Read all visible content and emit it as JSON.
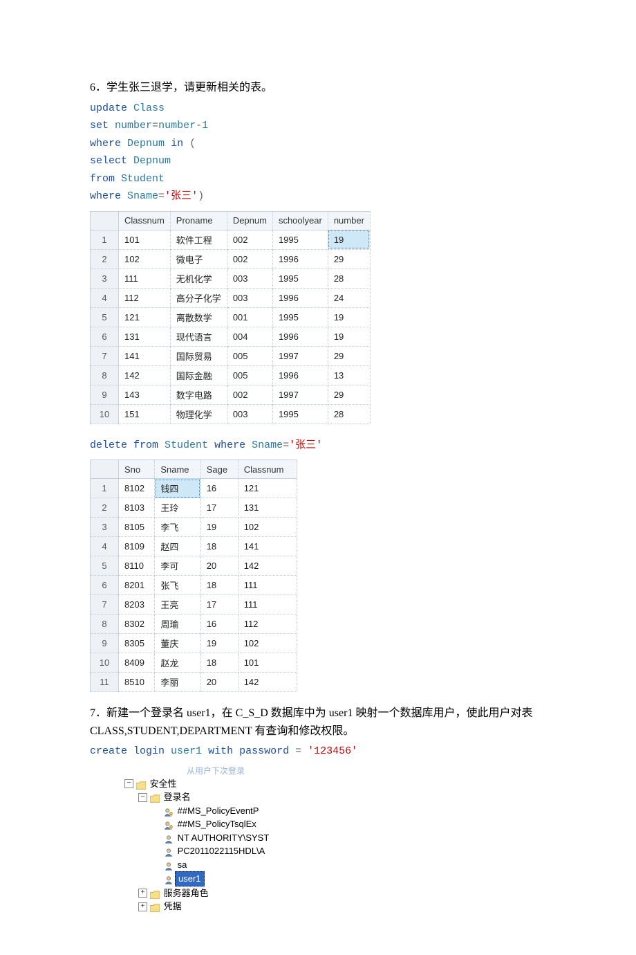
{
  "section6": {
    "title": "6．学生张三退学，请更新相关的表。",
    "sql_lines": [
      [
        {
          "t": "update",
          "c": "kw"
        },
        {
          "t": " ",
          "c": ""
        },
        {
          "t": "Class",
          "c": "id"
        }
      ],
      [
        {
          "t": "set",
          "c": "kw"
        },
        {
          "t": " ",
          "c": ""
        },
        {
          "t": "number",
          "c": "id"
        },
        {
          "t": "=",
          "c": "op"
        },
        {
          "t": "number",
          "c": "id"
        },
        {
          "t": "-",
          "c": "op"
        },
        {
          "t": "1",
          "c": "id"
        }
      ],
      [
        {
          "t": "where",
          "c": "kw"
        },
        {
          "t": " ",
          "c": ""
        },
        {
          "t": "Depnum",
          "c": "id"
        },
        {
          "t": " ",
          "c": ""
        },
        {
          "t": "in",
          "c": "kw"
        },
        {
          "t": " (",
          "c": "op"
        }
      ],
      [
        {
          "t": "select",
          "c": "kw"
        },
        {
          "t": " ",
          "c": ""
        },
        {
          "t": "Depnum",
          "c": "id"
        }
      ],
      [
        {
          "t": "from",
          "c": "kw"
        },
        {
          "t": " ",
          "c": ""
        },
        {
          "t": "Student",
          "c": "id"
        }
      ],
      [
        {
          "t": "where",
          "c": "kw"
        },
        {
          "t": " ",
          "c": ""
        },
        {
          "t": "Sname",
          "c": "id"
        },
        {
          "t": "=",
          "c": "op"
        },
        {
          "t": "'张三'",
          "c": "str"
        },
        {
          "t": ")",
          "c": "op"
        }
      ]
    ],
    "table1": {
      "headers": [
        "",
        "Classnum",
        "Proname",
        "Depnum",
        "schoolyear",
        "number"
      ],
      "rows": [
        [
          "1",
          "101",
          "软件工程",
          "002",
          "1995",
          "19"
        ],
        [
          "2",
          "102",
          "微电子",
          "002",
          "1996",
          "29"
        ],
        [
          "3",
          "111",
          "无机化学",
          "003",
          "1995",
          "28"
        ],
        [
          "4",
          "112",
          "高分子化学",
          "003",
          "1996",
          "24"
        ],
        [
          "5",
          "121",
          "离散数学",
          "001",
          "1995",
          "19"
        ],
        [
          "6",
          "131",
          "现代语言",
          "004",
          "1996",
          "19"
        ],
        [
          "7",
          "141",
          "国际贸易",
          "005",
          "1997",
          "29"
        ],
        [
          "8",
          "142",
          "国际金融",
          "005",
          "1996",
          "13"
        ],
        [
          "9",
          "143",
          "数字电路",
          "002",
          "1997",
          "29"
        ],
        [
          "10",
          "151",
          "物理化学",
          "003",
          "1995",
          "28"
        ]
      ],
      "highlight": {
        "row": 0,
        "col": 5
      }
    },
    "sql_delete": [
      [
        {
          "t": "delete from",
          "c": "kw"
        },
        {
          "t": " ",
          "c": ""
        },
        {
          "t": "Student",
          "c": "id"
        },
        {
          "t": " ",
          "c": ""
        },
        {
          "t": "where",
          "c": "kw"
        },
        {
          "t": " ",
          "c": ""
        },
        {
          "t": "Sname",
          "c": "id"
        },
        {
          "t": "=",
          "c": "op"
        },
        {
          "t": "'张三'",
          "c": "str"
        }
      ]
    ],
    "table2": {
      "headers": [
        "",
        "Sno",
        "Sname",
        "Sage",
        "Classnum"
      ],
      "rows": [
        [
          "1",
          "8102",
          "钱四",
          "16",
          "121"
        ],
        [
          "2",
          "8103",
          "王玲",
          "17",
          "131"
        ],
        [
          "3",
          "8105",
          "李飞",
          "19",
          "102"
        ],
        [
          "4",
          "8109",
          "赵四",
          "18",
          "141"
        ],
        [
          "5",
          "8110",
          "李可",
          "20",
          "142"
        ],
        [
          "6",
          "8201",
          "张飞",
          "18",
          "111"
        ],
        [
          "7",
          "8203",
          "王亮",
          "17",
          "111"
        ],
        [
          "8",
          "8302",
          "周瑜",
          "16",
          "112"
        ],
        [
          "9",
          "8305",
          "董庆",
          "19",
          "102"
        ],
        [
          "10",
          "8409",
          "赵龙",
          "18",
          "101"
        ],
        [
          "11",
          "8510",
          "李丽",
          "20",
          "142"
        ]
      ],
      "highlight": {
        "row": 0,
        "col": 2
      }
    }
  },
  "section7": {
    "title": "7．新建一个登录名 user1，在 C_S_D 数据库中为 user1 映射一个数据库用户，使此用户对表CLASS,STUDENT,DEPARTMENT 有查询和修改权限。",
    "sql_lines": [
      [
        {
          "t": "create login",
          "c": "kw"
        },
        {
          "t": " ",
          "c": ""
        },
        {
          "t": "user1",
          "c": "id"
        },
        {
          "t": " ",
          "c": ""
        },
        {
          "t": "with password",
          "c": "kw"
        },
        {
          "t": " = ",
          "c": "op"
        },
        {
          "t": "'123456'",
          "c": "str"
        }
      ]
    ],
    "tree": {
      "cut_top_text": "从用户下次登录",
      "nodes": [
        {
          "depth": 0,
          "exp": "-",
          "icon": "folder",
          "label": "安全性"
        },
        {
          "depth": 1,
          "exp": "-",
          "icon": "folder",
          "label": "登录名"
        },
        {
          "depth": 2,
          "exp": "",
          "icon": "user-key",
          "label": "##MS_PolicyEventP"
        },
        {
          "depth": 2,
          "exp": "",
          "icon": "user-key",
          "label": "##MS_PolicyTsqlEx"
        },
        {
          "depth": 2,
          "exp": "",
          "icon": "user",
          "label": "NT AUTHORITY\\SYST"
        },
        {
          "depth": 2,
          "exp": "",
          "icon": "user",
          "label": "PC2011022115HDL\\A"
        },
        {
          "depth": 2,
          "exp": "",
          "icon": "user",
          "label": "sa"
        },
        {
          "depth": 2,
          "exp": "",
          "icon": "user",
          "label": "user1",
          "selected": true
        },
        {
          "depth": 1,
          "exp": "+",
          "icon": "folder",
          "label": "服务器角色"
        },
        {
          "depth": 1,
          "exp": "+",
          "icon": "folder",
          "label": "凭据"
        }
      ]
    }
  }
}
